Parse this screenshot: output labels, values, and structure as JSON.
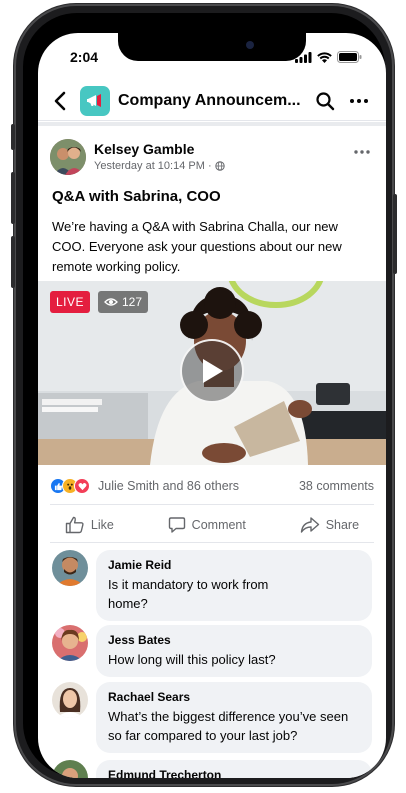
{
  "status": {
    "time": "2:04"
  },
  "header": {
    "title": "Company Announcem..."
  },
  "post": {
    "author": "Kelsey Gamble",
    "meta": "Yesterday at 10:14 PM ·",
    "title": "Q&A with Sabrina, COO",
    "body": "We’re having a Q&A with Sabrina Challa, our new COO. Everyone ask your questions about our new remote working policy."
  },
  "video": {
    "live_label": "LIVE",
    "viewer_count": "127"
  },
  "reactions": {
    "summary": "Julie Smith and 86 others",
    "comments": "38 comments"
  },
  "actions": {
    "like": "Like",
    "comment": "Comment",
    "share": "Share"
  },
  "comments": [
    {
      "name": "Jamie Reid",
      "text": "Is it mandatory to work from home?"
    },
    {
      "name": "Jess Bates",
      "text": "How long will this policy last?"
    },
    {
      "name": "Rachael Sears",
      "text": "What’s the biggest difference you’ve seen so far compared to your last job?"
    },
    {
      "name": "Edmund Trecherton",
      "text": ""
    }
  ],
  "colors": {
    "live": "#e41e3f",
    "group_icon": "#47c7c2",
    "like_blue": "#1877f2",
    "love_red": "#f33e58",
    "wow_yellow": "#f7b125"
  }
}
